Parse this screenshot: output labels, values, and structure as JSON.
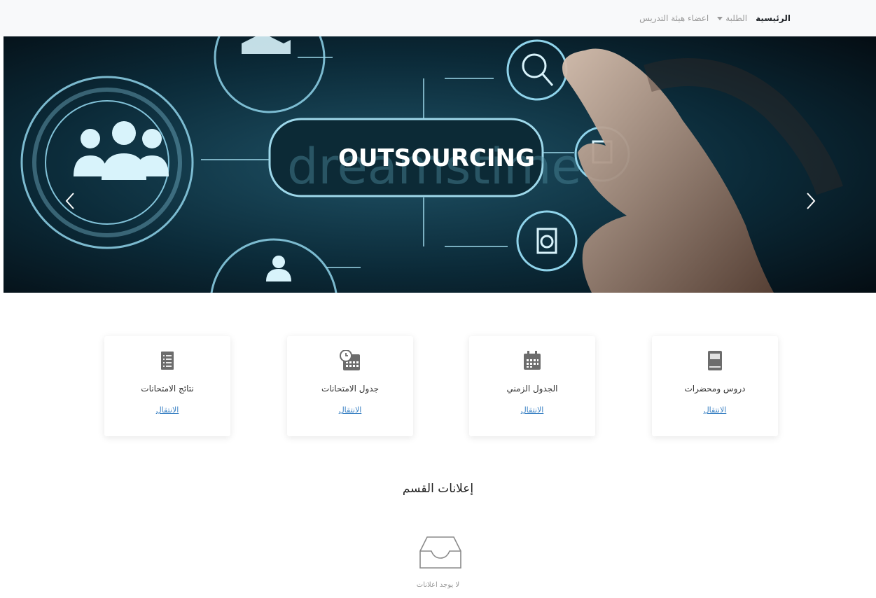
{
  "nav": {
    "home": "الرئيسية",
    "students": "الطلبة",
    "faculty": "اعضاء هيئة التدريس"
  },
  "hero": {
    "banner_text": "OUTSOURCING",
    "watermark_text": "dreamstime"
  },
  "cards": [
    {
      "title": "دروس ومحضرات",
      "link": "الانتقال",
      "icon": "book-icon"
    },
    {
      "title": "الجدول الزمني",
      "link": "الانتقال",
      "icon": "calendar-icon"
    },
    {
      "title": "جدول الامتحانات",
      "link": "الانتقال",
      "icon": "calendar-clock-icon"
    },
    {
      "title": "نتائج الامتحانات",
      "link": "الانتقال",
      "icon": "document-icon"
    }
  ],
  "announcements": {
    "title": "إعلانات القسم",
    "empty_text": "لا يوجد اعلانات",
    "empty_icon": "inbox-icon"
  },
  "colors": {
    "navbar_bg": "#f8f9fa",
    "link": "#3b82c4",
    "icon_gray": "#6c6c6c",
    "hero_dark": "#06141c",
    "hero_glow": "#8fd3ea"
  }
}
